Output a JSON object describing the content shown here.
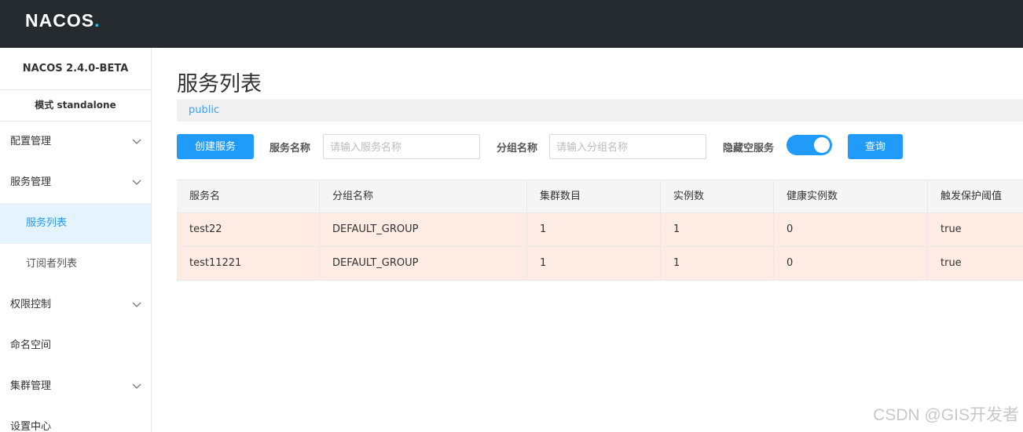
{
  "app": {
    "logo_main": "NACOS",
    "logo_dot": "."
  },
  "sidebar": {
    "version": "NACOS 2.4.0-BETA",
    "mode": "模式 standalone",
    "items": [
      {
        "label": "配置管理",
        "expandable": true
      },
      {
        "label": "服务管理",
        "expandable": true
      },
      {
        "label": "服务列表",
        "sub": true,
        "active": true
      },
      {
        "label": "订阅者列表",
        "sub": true
      },
      {
        "label": "权限控制",
        "expandable": true
      },
      {
        "label": "命名空间"
      },
      {
        "label": "集群管理",
        "expandable": true
      },
      {
        "label": "设置中心"
      }
    ]
  },
  "main": {
    "title": "服务列表",
    "namespace": "public",
    "create_button": "创建服务",
    "service_name_label": "服务名称",
    "service_name_placeholder": "请输入服务名称",
    "group_name_label": "分组名称",
    "group_name_placeholder": "请输入分组名称",
    "hide_empty_label": "隐藏空服务",
    "hide_empty_on": true,
    "query_button": "查询"
  },
  "table": {
    "headers": [
      "服务名",
      "分组名称",
      "集群数目",
      "实例数",
      "健康实例数",
      "触发保护阈值"
    ],
    "rows": [
      [
        "test22",
        "DEFAULT_GROUP",
        "1",
        "1",
        "0",
        "true"
      ],
      [
        "test11221",
        "DEFAULT_GROUP",
        "1",
        "1",
        "0",
        "true"
      ]
    ]
  },
  "watermark": "CSDN @GIS开发者",
  "colors": {
    "accent": "#209bfa",
    "topbar": "#252a2f",
    "row_highlight": "#fdebe4",
    "logo_accent": "#24c6e8"
  }
}
